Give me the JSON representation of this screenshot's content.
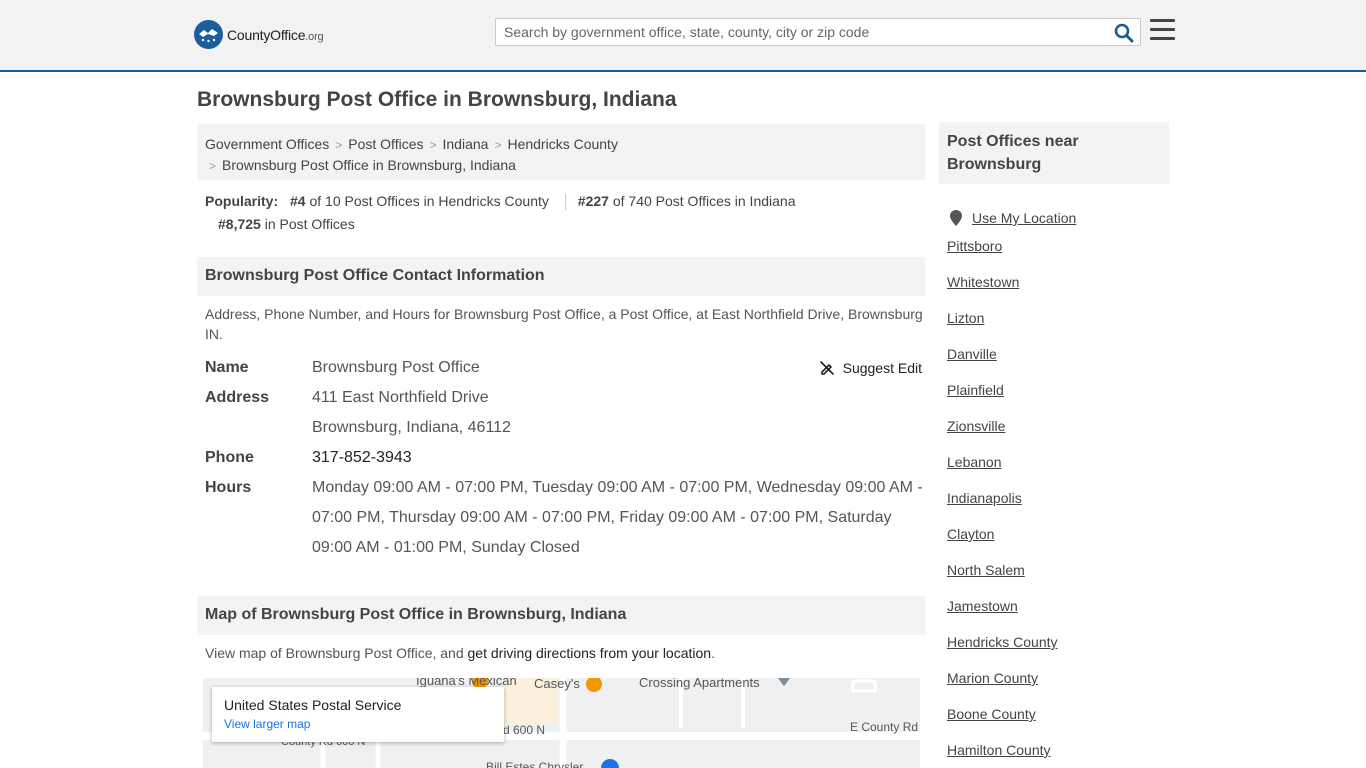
{
  "header": {
    "logo_text": "County",
    "logo_text_bold": "Office",
    "logo_text_suffix": ".org",
    "search_placeholder": "Search by government office, state, county, city or zip code"
  },
  "page": {
    "title": "Brownsburg Post Office in Brownsburg, Indiana"
  },
  "breadcrumb": {
    "items": [
      "Government Offices",
      "Post Offices",
      "Indiana",
      "Hendricks County"
    ],
    "current": "Brownsburg Post Office in Brownsburg, Indiana"
  },
  "popularity": {
    "label": "Popularity:",
    "county_rank": "#4",
    "county_text": "of 10 Post Offices in Hendricks County",
    "state_rank": "#227",
    "state_text": "of 740 Post Offices in Indiana",
    "national_rank": "#8,725",
    "national_text": "in Post Offices"
  },
  "contact": {
    "heading": "Brownsburg Post Office Contact Information",
    "intro": "Address, Phone Number, and Hours for Brownsburg Post Office, a Post Office, at East Northfield Drive, Brownsburg IN.",
    "suggest_edit": "Suggest Edit",
    "name_label": "Name",
    "name": "Brownsburg Post Office",
    "address_label": "Address",
    "address_line1": "411 East Northfield Drive",
    "address_line2": "Brownsburg, Indiana, 46112",
    "phone_label": "Phone",
    "phone": "317-852-3943",
    "hours_label": "Hours",
    "hours": "Monday 09:00 AM - 07:00 PM, Tuesday 09:00 AM - 07:00 PM, Wednesday 09:00 AM - 07:00 PM, Thursday 09:00 AM - 07:00 PM, Friday 09:00 AM - 07:00 PM, Saturday 09:00 AM - 01:00 PM, Sunday Closed"
  },
  "map": {
    "heading": "Map of Brownsburg Post Office in Brownsburg, Indiana",
    "intro": "View map of Brownsburg Post Office, and",
    "directions_link": "get driving directions from your location",
    "intro_end": ".",
    "card_title": "United States Postal Service",
    "card_link": "View larger map",
    "labels": {
      "iguanas": "Iguana's Mexican",
      "caseys": "Casey's",
      "crossing": "Crossing Apartments",
      "road600": "d 600 N",
      "county_rd_e": "E County Rd C",
      "county_rd_w": "County Rd 600 N",
      "bill_estes": "Bill Estes Chrysler"
    }
  },
  "sidebar": {
    "heading": "Post Offices near Brownsburg",
    "use_location": "Use My Location",
    "items": [
      "Pittsboro",
      "Whitestown",
      "Lizton",
      "Danville",
      "Plainfield",
      "Zionsville",
      "Lebanon",
      "Indianapolis",
      "Clayton",
      "North Salem",
      "Jamestown",
      "Hendricks County",
      "Marion County",
      "Boone County",
      "Hamilton County"
    ]
  }
}
